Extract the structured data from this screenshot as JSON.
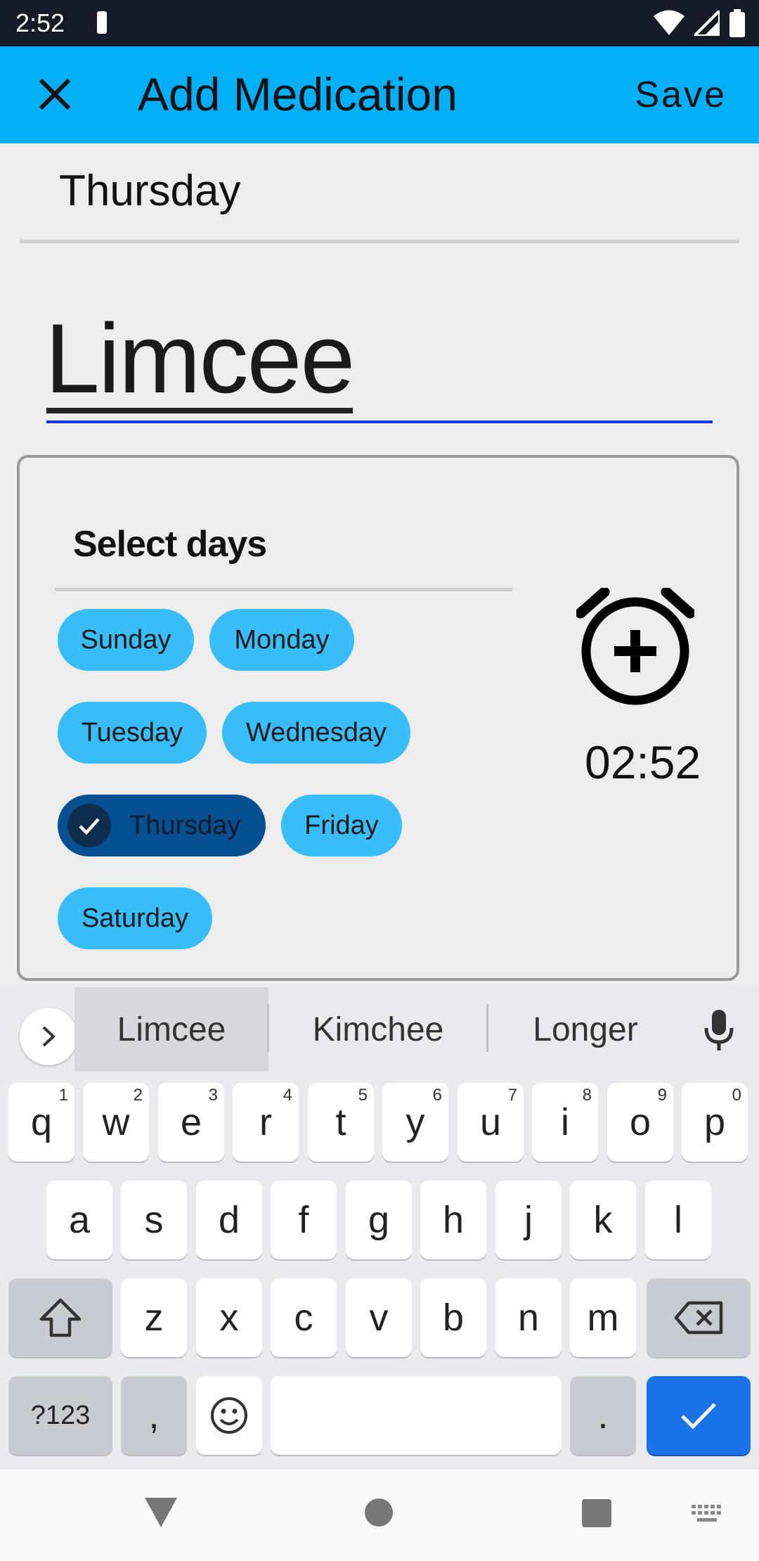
{
  "status_bar": {
    "time": "2:52"
  },
  "app_bar": {
    "title": "Add Medication",
    "save_label": "Save"
  },
  "date_header": "Thursday",
  "medication_name": "Limcee",
  "schedule": {
    "heading": "Select days",
    "days": [
      {
        "label": "Sunday",
        "selected": false
      },
      {
        "label": "Monday",
        "selected": false
      },
      {
        "label": "Tuesday",
        "selected": false
      },
      {
        "label": "Wednesday",
        "selected": false
      },
      {
        "label": "Thursday",
        "selected": true
      },
      {
        "label": "Friday",
        "selected": false
      },
      {
        "label": "Saturday",
        "selected": false
      }
    ],
    "time": "02:52",
    "alarm_icon": "alarm-add-icon"
  },
  "keyboard": {
    "suggestions": [
      "Limcee",
      "Kimchee",
      "Longer"
    ],
    "row1": [
      "q",
      "w",
      "e",
      "r",
      "t",
      "y",
      "u",
      "i",
      "o",
      "p"
    ],
    "row1_hints": [
      "1",
      "2",
      "3",
      "4",
      "5",
      "6",
      "7",
      "8",
      "9",
      "0"
    ],
    "row2": [
      "a",
      "s",
      "d",
      "f",
      "g",
      "h",
      "j",
      "k",
      "l"
    ],
    "row3": [
      "z",
      "x",
      "c",
      "v",
      "b",
      "n",
      "m"
    ],
    "symbols_label": "?123",
    "comma": ",",
    "period": "."
  },
  "colors": {
    "app_bar": "#03b0f7",
    "chip": "#38bdf8",
    "chip_selected": "#064f91",
    "name_underline": "#1333e6",
    "done_key": "#1a73e8"
  }
}
